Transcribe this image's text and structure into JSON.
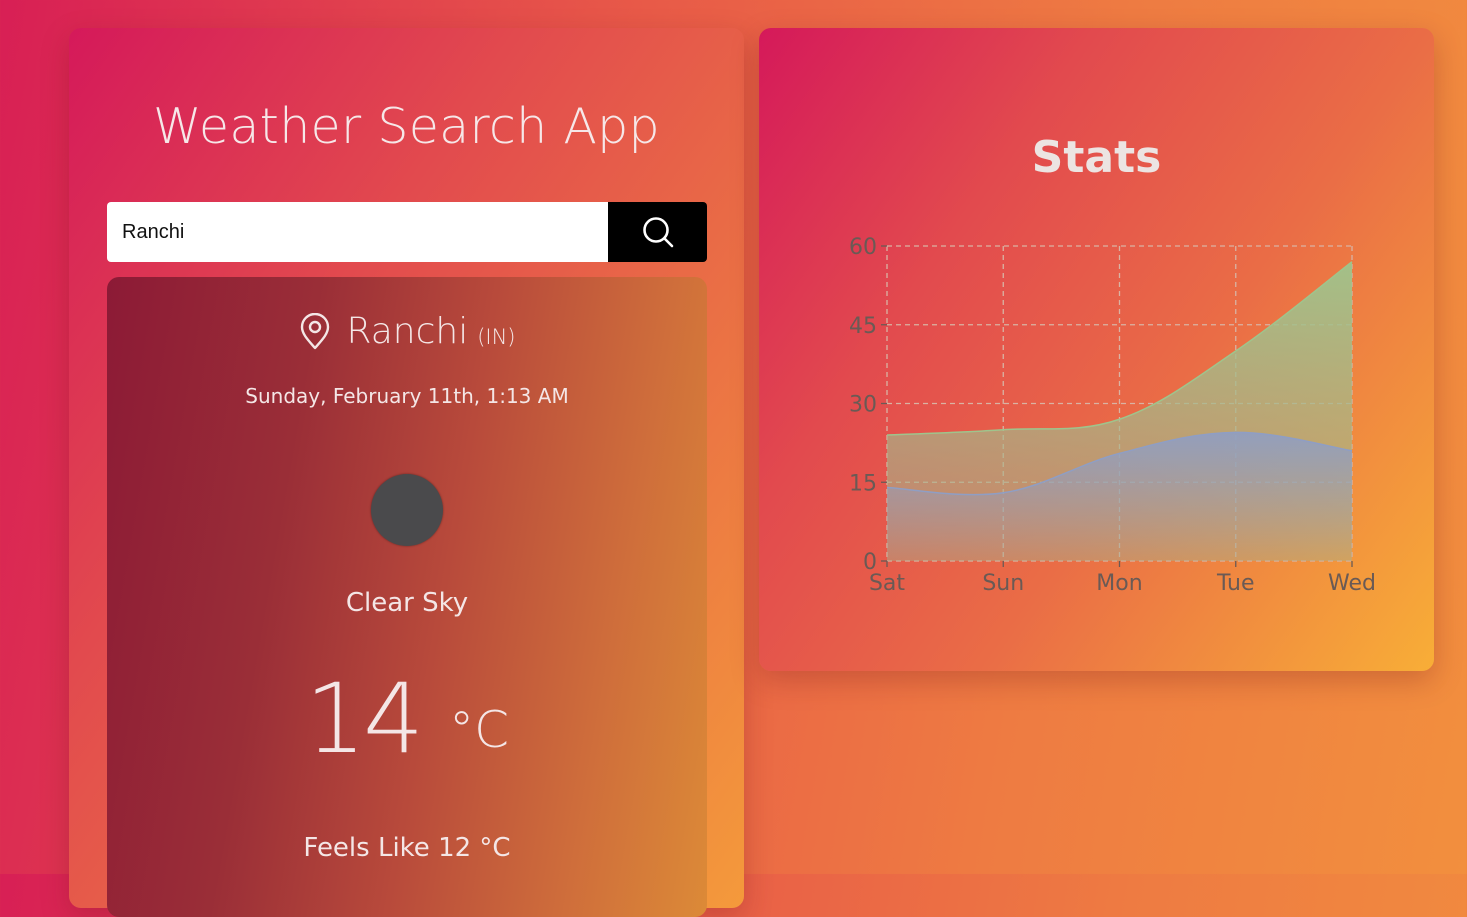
{
  "app": {
    "title": "Weather Search App"
  },
  "search": {
    "value": "Ranchi",
    "button_icon": "search-icon"
  },
  "weather": {
    "city": "Ranchi",
    "country": "(IN)",
    "datetime": "Sunday, February 11th, 1:13 AM",
    "icon": "clear-sky-icon",
    "condition": "Clear Sky",
    "temperature": "14",
    "temp_unit": "°C",
    "feels_like": "Feels Like 12 °C"
  },
  "stats": {
    "title": "Stats",
    "chart_data": {
      "type": "area",
      "categories": [
        "Sat",
        "Sun",
        "Mon",
        "Tue",
        "Wed"
      ],
      "ylim": [
        0,
        60
      ],
      "yticks": [
        0,
        15,
        30,
        45,
        60
      ],
      "grid": true,
      "series": [
        {
          "values": [
            24,
            25,
            27,
            40,
            57
          ],
          "color": "#9fc48c"
        },
        {
          "values": [
            14,
            13,
            20.5,
            24.5,
            21
          ],
          "color": "#8f9ec4"
        }
      ]
    }
  }
}
